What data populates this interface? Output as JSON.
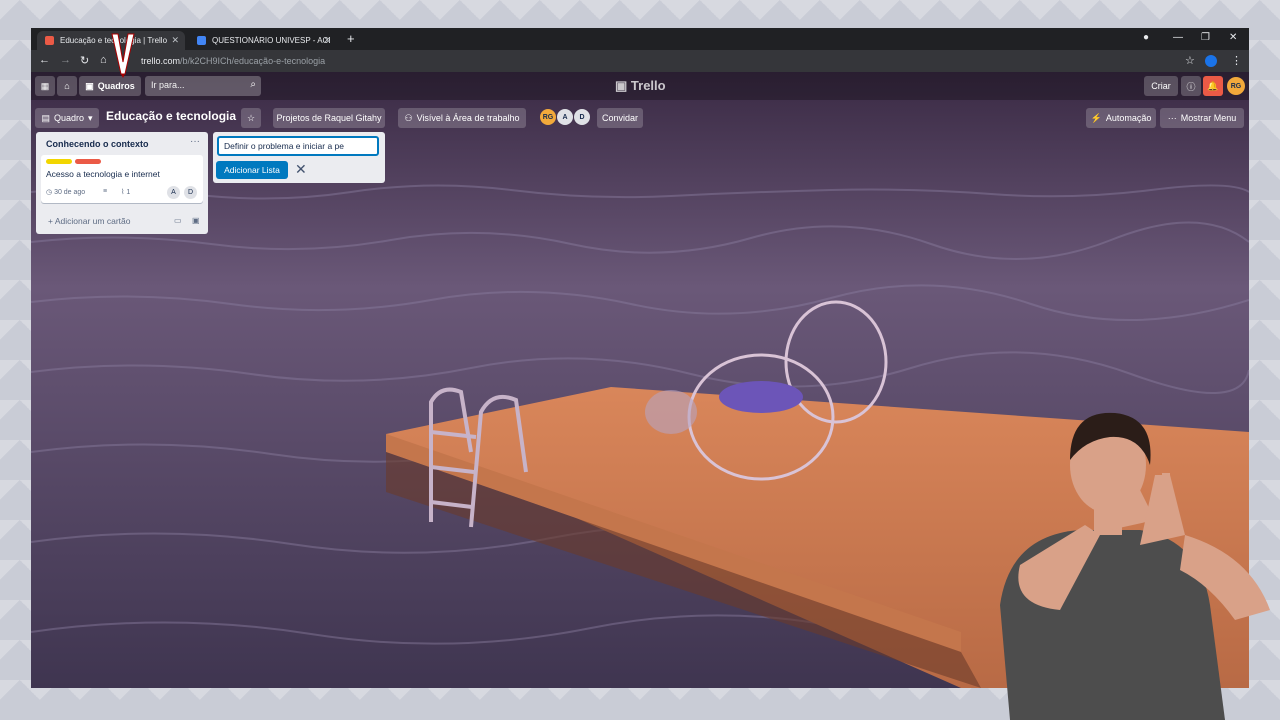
{
  "browser": {
    "tabs": [
      {
        "title": "Educação e tecnologia | Trello",
        "favicon_color": "#eb5a46",
        "active": true
      },
      {
        "title": "QUESTIONÁRIO UNIVESP - ACES",
        "favicon_color": "#4285f4",
        "active": false
      }
    ],
    "new_tab": "+",
    "url_main": "trello.com",
    "url_path": "/b/k2CH9ICh/educação-e-tecnologia"
  },
  "topnav": {
    "boards_label": "Quadros",
    "search_placeholder": "Ir para...",
    "logo": "Trello",
    "create_label": "Criar",
    "user_initials": "RG"
  },
  "boardbar": {
    "view_label": "Quadro",
    "title": "Educação e tecnologia",
    "workspace_label": "Projetos de Raquel Gitahy",
    "visibility_label": "Visível à Área de trabalho",
    "members": [
      "RG",
      "A",
      "D"
    ],
    "invite_label": "Convidar",
    "automation_label": "Automação",
    "menu_label": "Mostrar Menu"
  },
  "list": {
    "title": "Conhecendo o contexto",
    "card": {
      "labels": [
        "#f2d600",
        "#eb5a46"
      ],
      "title": "Acesso a tecnologia e internet",
      "due": "30 de ago",
      "attachments": "1",
      "members": [
        "A",
        "D"
      ]
    },
    "add_card_label": "Adicionar um cartão"
  },
  "composer": {
    "value": "Definir o problema e iniciar a pe",
    "button_label": "Adicionar Lista"
  },
  "colors": {
    "accent": "#0079bf",
    "avatar_rg": "#f2a93b"
  }
}
